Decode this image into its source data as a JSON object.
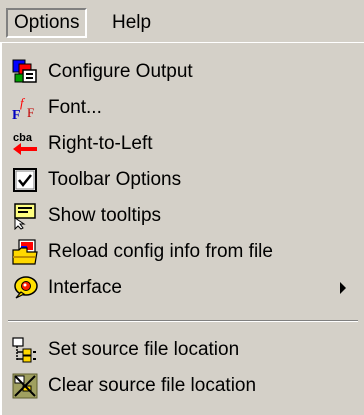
{
  "menubar": {
    "items": [
      {
        "label": "Options"
      },
      {
        "label": "Help"
      }
    ]
  },
  "menu": {
    "items": [
      {
        "label": "Configure Output",
        "icon": "configure-output-icon"
      },
      {
        "label": "Font...",
        "icon": "font-icon"
      },
      {
        "label": "Right-to-Left",
        "icon": "right-to-left-icon"
      },
      {
        "label": "Toolbar Options",
        "icon": "checkbox-icon"
      },
      {
        "label": "Show tooltips",
        "icon": "tooltip-icon"
      },
      {
        "label": "Reload config info from file",
        "icon": "reload-config-icon"
      },
      {
        "label": "Interface",
        "icon": "interface-icon",
        "submenu": true
      },
      {
        "label": "Set source file location",
        "icon": "set-location-icon"
      },
      {
        "label": "Clear source file location",
        "icon": "clear-location-icon"
      }
    ]
  }
}
